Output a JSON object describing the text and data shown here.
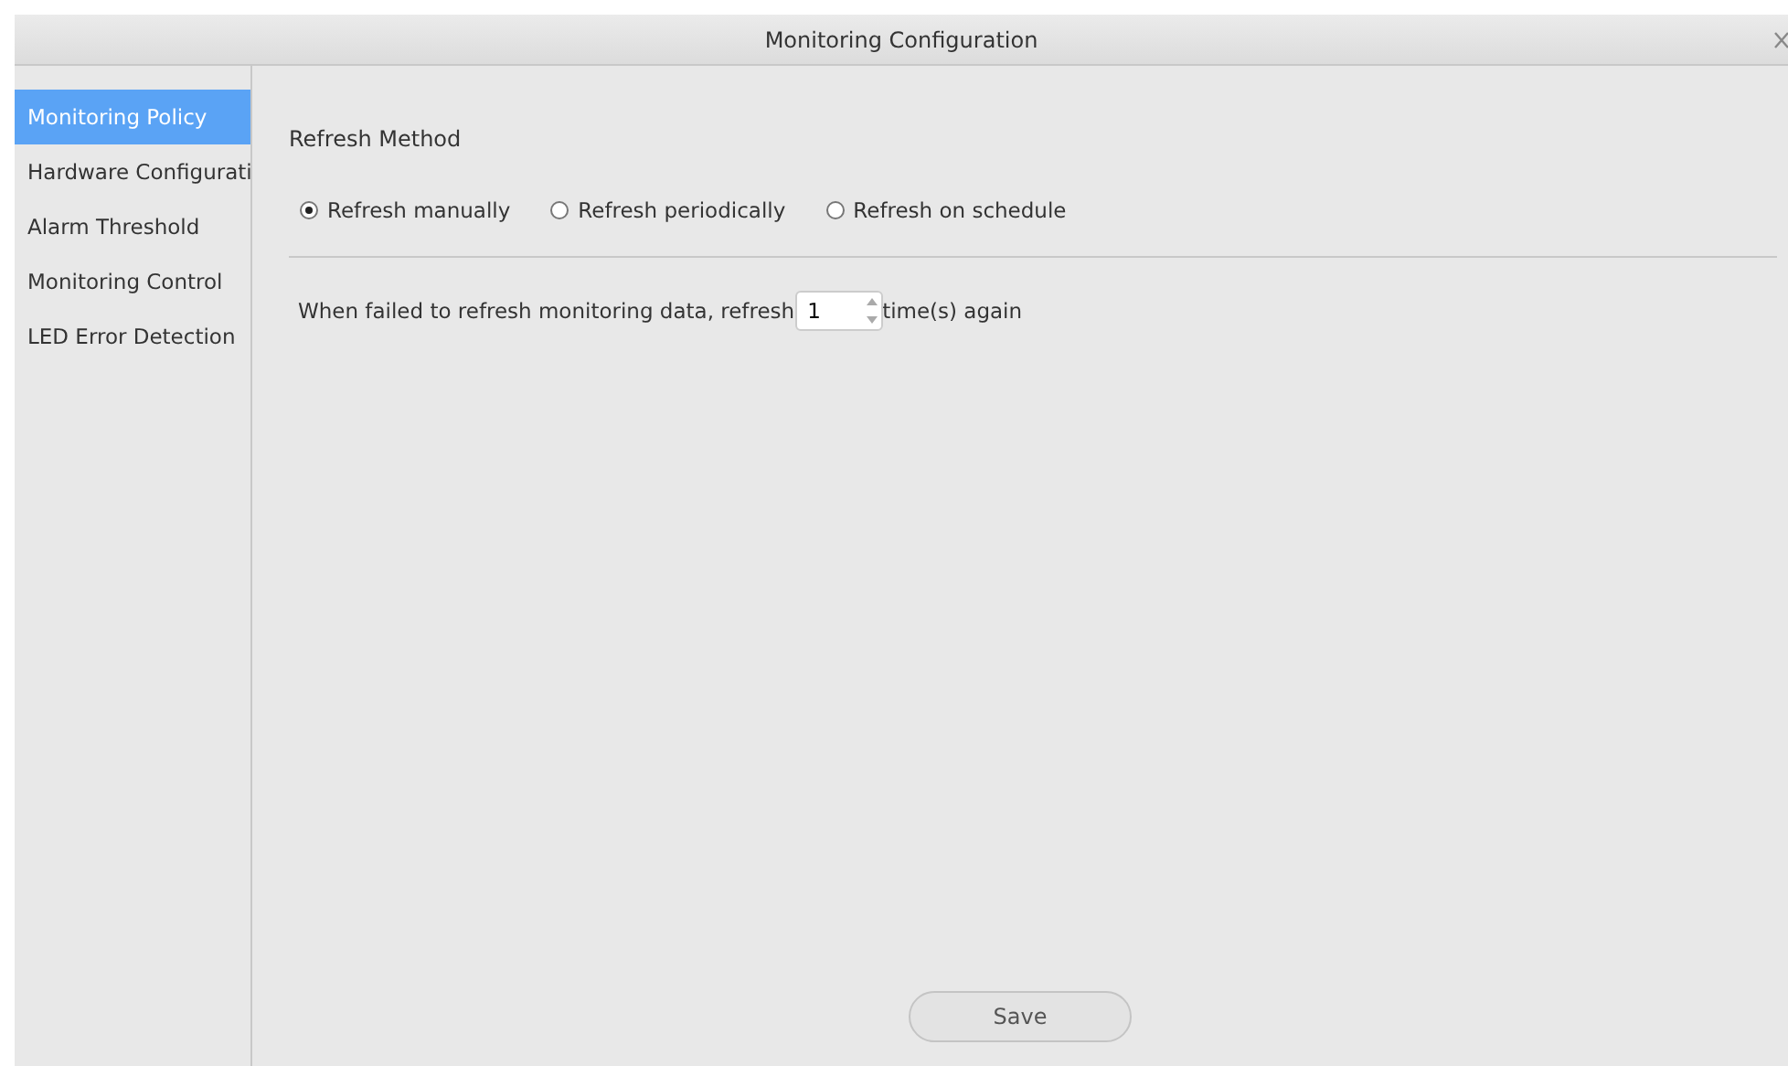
{
  "window": {
    "title": "Monitoring Configuration"
  },
  "sidebar": {
    "items": [
      {
        "label": "Monitoring Policy",
        "selected": true
      },
      {
        "label": "Hardware Configurati",
        "selected": false
      },
      {
        "label": "Alarm Threshold",
        "selected": false
      },
      {
        "label": "Monitoring Control",
        "selected": false
      },
      {
        "label": "LED Error Detection",
        "selected": false
      }
    ]
  },
  "refresh_method": {
    "title": "Refresh Method",
    "options": [
      {
        "label": "Refresh manually",
        "selected": true
      },
      {
        "label": "Refresh periodically",
        "selected": false
      },
      {
        "label": "Refresh on schedule",
        "selected": false
      }
    ]
  },
  "retry": {
    "prefix": "When failed to refresh monitoring data, refresh",
    "value": "1",
    "suffix": "time(s) again"
  },
  "buttons": [
    "Save"
  ]
}
